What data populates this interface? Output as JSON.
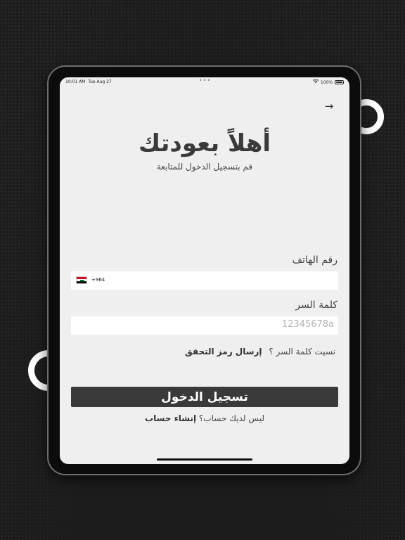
{
  "status_bar": {
    "time": "10:01 AM",
    "date": "Tue Aug 27",
    "dots": "•••",
    "battery": "100%"
  },
  "screen": {
    "back_arrow": "→",
    "title": "أهلاً بعودتك",
    "subtitle": "قم بتسجيل الدخول للمتابعة"
  },
  "form": {
    "phone_label": "رقم الهاتف",
    "dial_code": "+964",
    "password_label": "كلمة السر",
    "password_value": "12345678a"
  },
  "links": {
    "forgot_text": "نسيت كلمة السر ؟",
    "send_code": "إرسال رمز التحقق",
    "no_account": "ليس لديك حساب؟",
    "create_account": "إنشاء حساب"
  },
  "buttons": {
    "login": "تسجيل الدخول"
  },
  "colors": {
    "background": "#1d1d1d",
    "screen": "#efefef",
    "button": "#3a3a3a"
  },
  "icons": [
    "arrow-right-icon",
    "iraq-flag-icon",
    "wifi-icon",
    "battery-icon"
  ]
}
